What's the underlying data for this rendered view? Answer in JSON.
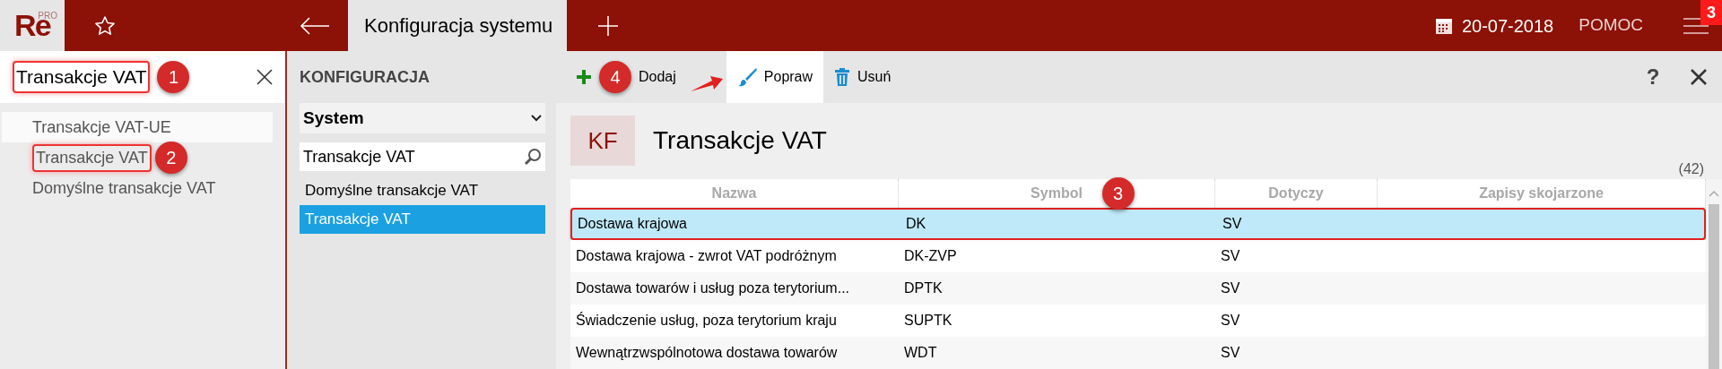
{
  "app": {
    "logo": "Re",
    "logo_badge": "PRO"
  },
  "top_bar": {
    "tab": "Konfiguracja systemu",
    "date": "20-07-2018",
    "help": "POMOC",
    "menu_badge": "3"
  },
  "left_panel": {
    "search": {
      "value": "Transakcje VAT",
      "callout": "1"
    },
    "results": [
      {
        "label": "Transakcje VAT-UE",
        "selected": true
      },
      {
        "label": "Transakcje VAT",
        "selected": false,
        "callout": "2"
      },
      {
        "label": "Domyślne transakcje VAT",
        "selected": false
      }
    ]
  },
  "middle_panel": {
    "heading": "KONFIGURACJA",
    "category": "System",
    "search": {
      "value": "Transakcje VAT"
    },
    "items": [
      {
        "label": "Domyślne transakcje VAT",
        "selected": false
      },
      {
        "label": "Transakcje VAT",
        "selected": true
      }
    ]
  },
  "toolbar": {
    "buttons": [
      {
        "label": "Dodaj",
        "kind": "add",
        "selected": false,
        "callout": "4"
      },
      {
        "label": "Popraw",
        "kind": "edit",
        "selected": true
      },
      {
        "label": "Usuń",
        "kind": "delete",
        "selected": false
      }
    ],
    "help": "?"
  },
  "record": {
    "badge": "KF",
    "title": "Transakcje VAT",
    "count": "(42)"
  },
  "table": {
    "columns": [
      {
        "label": "Nazwa"
      },
      {
        "label": "Symbol",
        "callout": "3"
      },
      {
        "label": "Dotyczy"
      },
      {
        "label": "Zapisy skojarzone"
      }
    ],
    "rows": [
      {
        "cells": [
          "Dostawa krajowa",
          "DK",
          "SV"
        ],
        "selected": true
      },
      {
        "cells": [
          "Dostawa krajowa - zwrot VAT podróżnym",
          "DK-ZVP",
          "SV"
        ],
        "selected": false
      },
      {
        "cells": [
          "Dostawa towarów i usług poza terytorium...",
          "DPTK",
          "SV"
        ],
        "selected": false
      },
      {
        "cells": [
          "Świadczenie usług, poza terytorium kraju",
          "SUPTK",
          "SV"
        ],
        "selected": false
      },
      {
        "cells": [
          "Wewnątrzwspólnotowa dostawa towarów",
          "WDT",
          "SV"
        ],
        "selected": false
      }
    ]
  }
}
